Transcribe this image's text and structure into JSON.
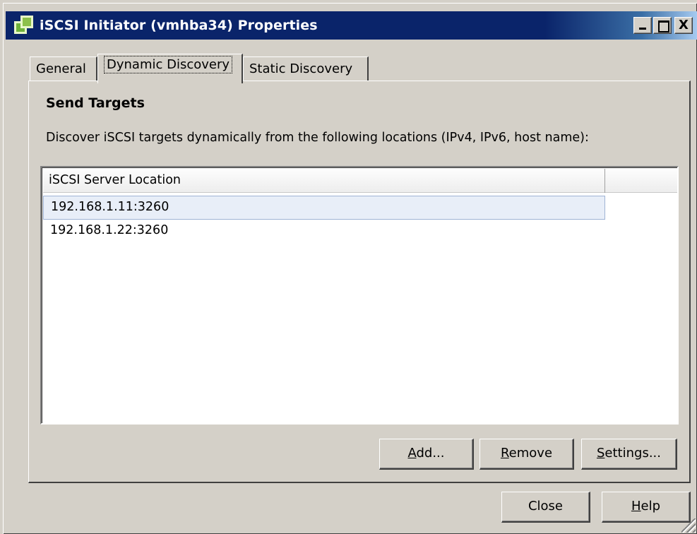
{
  "window": {
    "title": "iSCSI Initiator (vmhba34) Properties",
    "controls": {
      "minimize": "_",
      "maximize": "□",
      "close": "X"
    }
  },
  "tabs": [
    {
      "label": "General",
      "active": false
    },
    {
      "label": "Dynamic Discovery",
      "active": true
    },
    {
      "label": "Static Discovery",
      "active": false
    }
  ],
  "panel": {
    "section_title": "Send Targets",
    "description": "Discover iSCSI targets dynamically from the following locations (IPv4, IPv6, host name):",
    "list": {
      "columns": [
        "iSCSI Server Location",
        ""
      ],
      "rows": [
        {
          "location": "192.168.1.11:3260",
          "selected": true
        },
        {
          "location": "192.168.1.22:3260",
          "selected": false
        }
      ]
    },
    "buttons": {
      "add": {
        "mnemonic": "A",
        "rest": "dd..."
      },
      "remove": {
        "mnemonic": "R",
        "rest": "emove"
      },
      "settings": {
        "mnemonic": "S",
        "rest": "ettings..."
      }
    }
  },
  "footer": {
    "close_label": "Close",
    "help": {
      "mnemonic": "H",
      "rest": "elp"
    }
  },
  "colors": {
    "titlebar_start": "#0a246a",
    "titlebar_end": "#a6caf0",
    "dialog_face": "#d4d0c8",
    "selection_bg": "#e8eef8",
    "selection_border": "#9fb3d4"
  }
}
